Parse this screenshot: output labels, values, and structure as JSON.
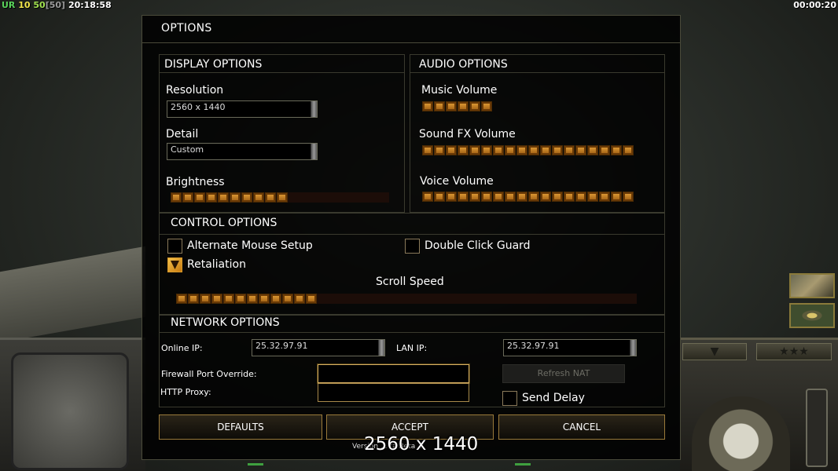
{
  "hud": {
    "ur": "UR",
    "val1": "10",
    "val2": "50",
    "bracket": "[50]",
    "clock": "20:18:58",
    "timer": "00:00:20"
  },
  "dialog": {
    "title": "OPTIONS",
    "display": {
      "header": "DISPLAY OPTIONS",
      "resolution_label": "Resolution",
      "resolution_value": "2560 x 1440",
      "detail_label": "Detail",
      "detail_value": "Custom",
      "brightness_label": "Brightness",
      "brightness_level": 10
    },
    "audio": {
      "header": "AUDIO OPTIONS",
      "music_label": "Music Volume",
      "music_level": 6,
      "sfx_label": "Sound FX Volume",
      "sfx_level": 18,
      "voice_label": "Voice Volume",
      "voice_level": 18
    },
    "control": {
      "header": "CONTROL OPTIONS",
      "alt_mouse_label": "Alternate Mouse Setup",
      "alt_mouse_checked": false,
      "double_click_label": "Double Click Guard",
      "double_click_checked": false,
      "retaliation_label": "Retaliation",
      "retaliation_checked": true,
      "scroll_label": "Scroll Speed",
      "scroll_level": 12
    },
    "network": {
      "header": "NETWORK OPTIONS",
      "online_ip_label": "Online IP:",
      "online_ip_value": "25.32.97.91",
      "lan_ip_label": "LAN IP:",
      "lan_ip_value": "25.32.97.91",
      "firewall_label": "Firewall Port Override:",
      "firewall_value": "",
      "proxy_label": "HTTP Proxy:",
      "proxy_value": "",
      "refresh_nat_label": "Refresh NAT",
      "send_delay_label": "Send Delay",
      "send_delay_checked": false
    },
    "buttons": {
      "defaults": "DEFAULTS",
      "accept": "ACCEPT",
      "cancel": "CANCEL"
    },
    "version_text": "Version ... ra Beta ...",
    "resolution_overlay": "2560 x 1440"
  },
  "colors": {
    "slider_fill": "#e8a33a",
    "border": "#3a3a2e",
    "led": "#3fa03f"
  }
}
